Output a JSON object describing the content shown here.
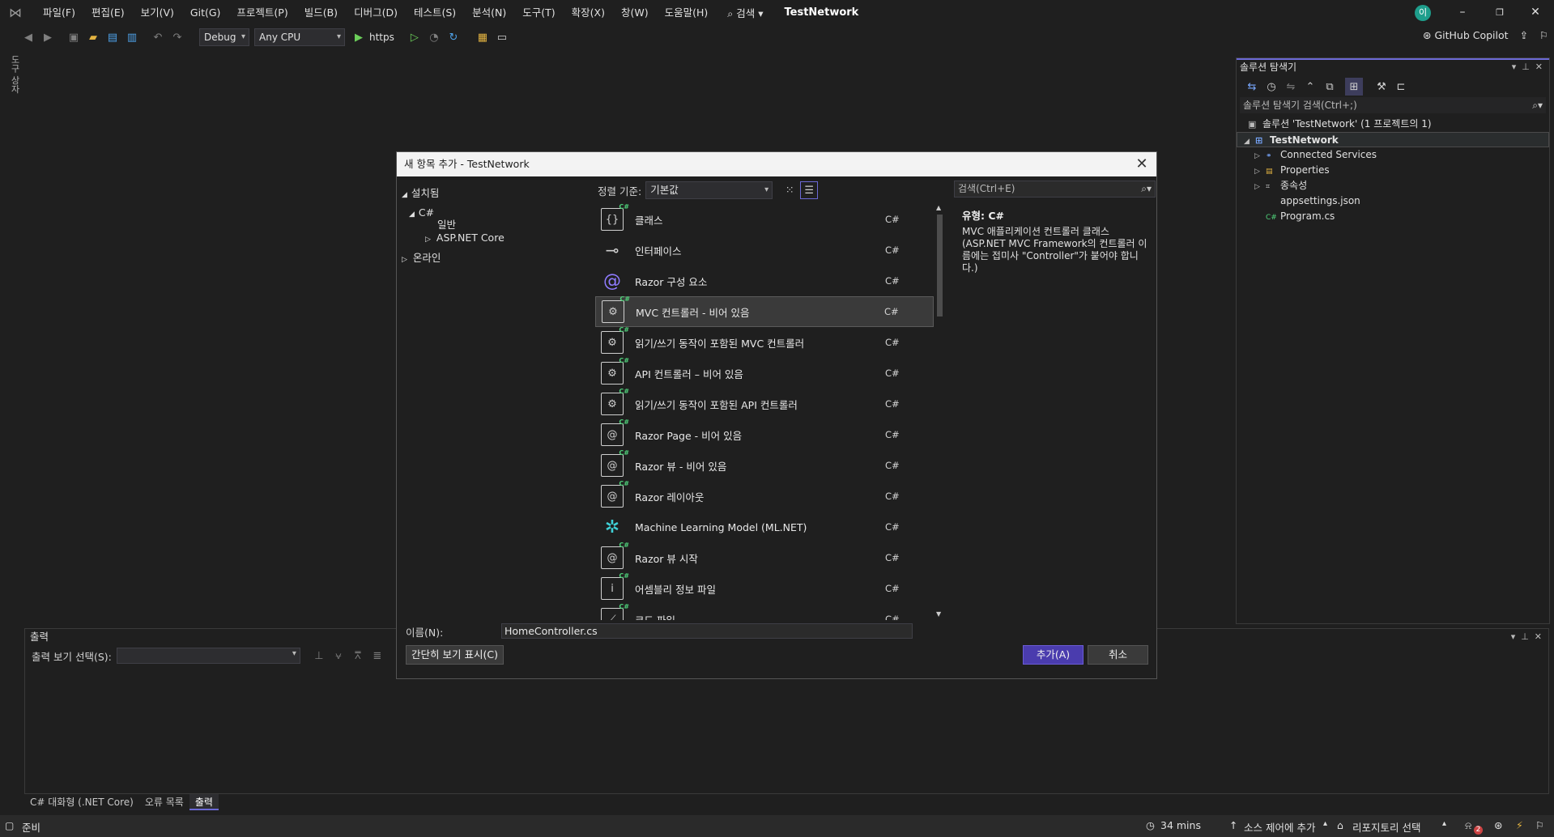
{
  "titlebar": {
    "menu": [
      "파일(F)",
      "편집(E)",
      "보기(V)",
      "Git(G)",
      "프로젝트(P)",
      "빌드(B)",
      "디버그(D)",
      "테스트(S)",
      "분석(N)",
      "도구(T)",
      "확장(X)",
      "창(W)",
      "도움말(H)"
    ],
    "search_label": "⌕ 검색 ▾",
    "app_title": "TestNetwork",
    "avatar_initial": "이"
  },
  "toolbar": {
    "config": "Debug",
    "platform": "Any CPU",
    "run_target": "https",
    "copilot": "GitHub Copilot"
  },
  "toolbox_tab": "도구 상자",
  "solution_explorer": {
    "title": "솔루션 탐색기",
    "search_placeholder": "솔루션 탐색기 검색(Ctrl+;)",
    "solution_label": "솔루션 'TestNetwork' (1 프로젝트의 1)",
    "project": "TestNetwork",
    "items": [
      {
        "label": "Connected Services",
        "icon": "connected-services-icon"
      },
      {
        "label": "Properties",
        "icon": "properties-icon"
      },
      {
        "label": "종속성",
        "icon": "dependencies-icon"
      },
      {
        "label": "appsettings.json",
        "icon": "json-file-icon"
      },
      {
        "label": "Program.cs",
        "icon": "csharp-file-icon"
      }
    ]
  },
  "output_panel": {
    "title": "출력",
    "show_from_label": "출력 보기 선택(S):",
    "show_from_value": ""
  },
  "bottom_tabs": [
    "C# 대화형 (.NET Core)",
    "오류 목록",
    "출력"
  ],
  "statusbar": {
    "ready": "준비",
    "time": "34 mins",
    "source_control": "소스 제어에 추가",
    "repository": "리포지토리 선택",
    "notification_count": "2"
  },
  "dialog": {
    "title": "새 항목 추가 - TestNetwork",
    "tree": {
      "installed": "설치됨",
      "csharp": "C#",
      "general": "일반",
      "aspnet_core": "ASP.NET Core",
      "online": "온라인"
    },
    "sort_label": "정렬 기준:",
    "sort_value": "기본값",
    "search_placeholder": "검색(Ctrl+E)",
    "templates": [
      {
        "name": "클래스",
        "lang": "C#",
        "icon": "class-icon"
      },
      {
        "name": "인터페이스",
        "lang": "C#",
        "icon": "interface-icon"
      },
      {
        "name": "Razor 구성 요소",
        "lang": "C#",
        "icon": "razor-component-icon"
      },
      {
        "name": "MVC 컨트롤러 - 비어 있음",
        "lang": "C#",
        "icon": "mvc-controller-icon"
      },
      {
        "name": "읽기/쓰기 동작이 포함된 MVC 컨트롤러",
        "lang": "C#",
        "icon": "mvc-controller-rw-icon"
      },
      {
        "name": "API 컨트롤러 – 비어 있음",
        "lang": "C#",
        "icon": "api-controller-icon"
      },
      {
        "name": "읽기/쓰기 동작이 포함된 API 컨트롤러",
        "lang": "C#",
        "icon": "api-controller-rw-icon"
      },
      {
        "name": "Razor Page - 비어 있음",
        "lang": "C#",
        "icon": "razor-page-icon"
      },
      {
        "name": "Razor 뷰 - 비어 있음",
        "lang": "C#",
        "icon": "razor-view-icon"
      },
      {
        "name": "Razor 레이아웃",
        "lang": "C#",
        "icon": "razor-layout-icon"
      },
      {
        "name": "Machine Learning Model (ML.NET)",
        "lang": "C#",
        "icon": "ml-model-icon"
      },
      {
        "name": "Razor 뷰 시작",
        "lang": "C#",
        "icon": "razor-viewstart-icon"
      },
      {
        "name": "어셈블리 정보 파일",
        "lang": "C#",
        "icon": "assembly-info-icon"
      },
      {
        "name": "코드 파일",
        "lang": "C#",
        "icon": "code-file-icon"
      }
    ],
    "selected_index": 3,
    "detail_type_label": "유형:",
    "detail_type_value": "C#",
    "detail_description": "MVC 애플리케이션 컨트롤러 클래스(ASP.NET MVC Framework의 컨트롤러 이름에는 접미사 \"Controller\"가 붙어야 합니다.)",
    "name_label": "이름(N):",
    "name_value": "HomeController.cs",
    "compact_view_button": "간단히 보기 표시(C)",
    "add_button": "추가(A)",
    "cancel_button": "취소"
  }
}
